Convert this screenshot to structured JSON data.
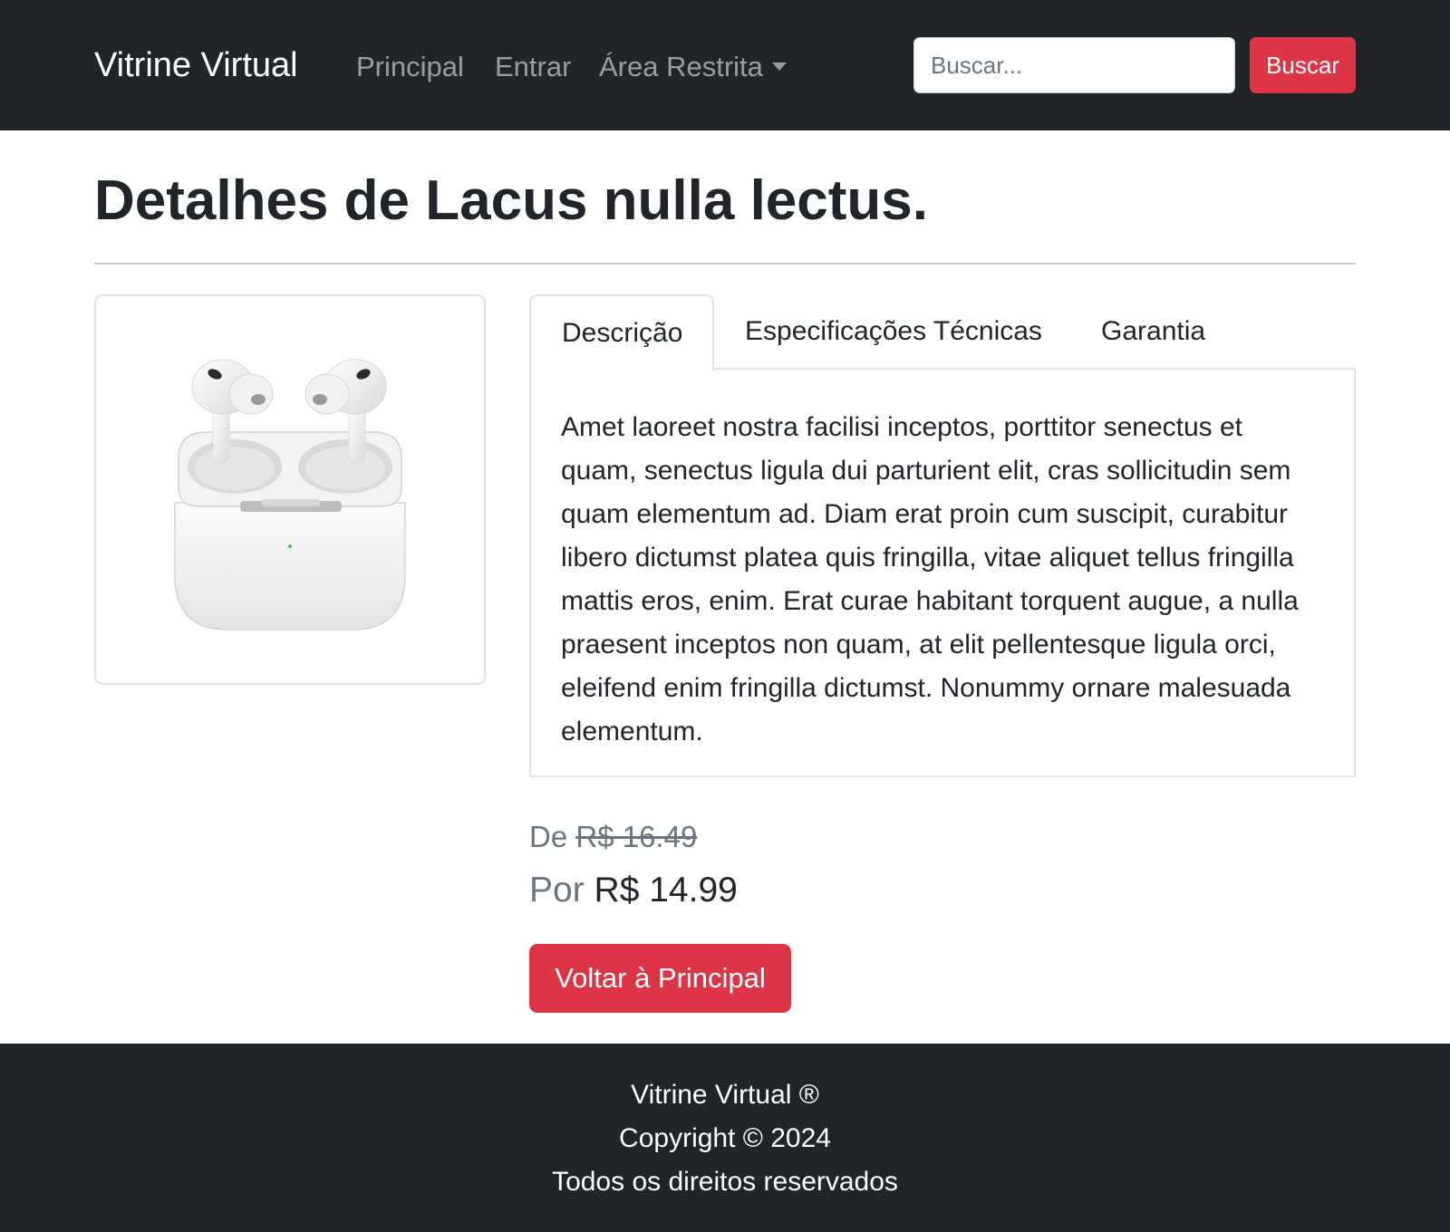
{
  "navbar": {
    "brand": "Vitrine Virtual",
    "links": [
      {
        "label": "Principal"
      },
      {
        "label": "Entrar"
      },
      {
        "label": "Área Restrita"
      }
    ],
    "search": {
      "placeholder": "Buscar...",
      "value": "",
      "button_label": "Buscar"
    }
  },
  "page": {
    "title_prefix": "Detalhes de ",
    "product_name": "Lacus nulla lectus."
  },
  "product": {
    "image_icon": "earbuds-case-image"
  },
  "tabs": [
    {
      "label": "Descrição",
      "active": true
    },
    {
      "label": "Especificações Técnicas",
      "active": false
    },
    {
      "label": "Garantia",
      "active": false
    }
  ],
  "description": "Amet laoreet nostra facilisi inceptos, porttitor senectus et quam, senectus ligula dui parturient elit, cras sollicitudin sem quam elementum ad. Diam erat proin cum suscipit, curabitur libero dictumst platea quis fringilla, vitae aliquet tellus fringilla mattis eros, enim. Erat curae habitant torquent augue, a nulla praesent inceptos non quam, at elit pellentesque ligula orci, eleifend enim fringilla dictumst. Nonummy ornare malesuada elementum.",
  "pricing": {
    "old_prefix": "De",
    "old_price": "R$ 16.49",
    "new_prefix": "Por",
    "new_price": "R$ 14.99"
  },
  "actions": {
    "back_label": "Voltar à Principal"
  },
  "footer": {
    "line1": "Vitrine Virtual ®",
    "line2": "Copyright © 2024",
    "line3": "Todos os direitos reservados"
  },
  "colors": {
    "navbar_bg": "#212529",
    "accent_red": "#dc3545",
    "muted": "#6c757d"
  }
}
